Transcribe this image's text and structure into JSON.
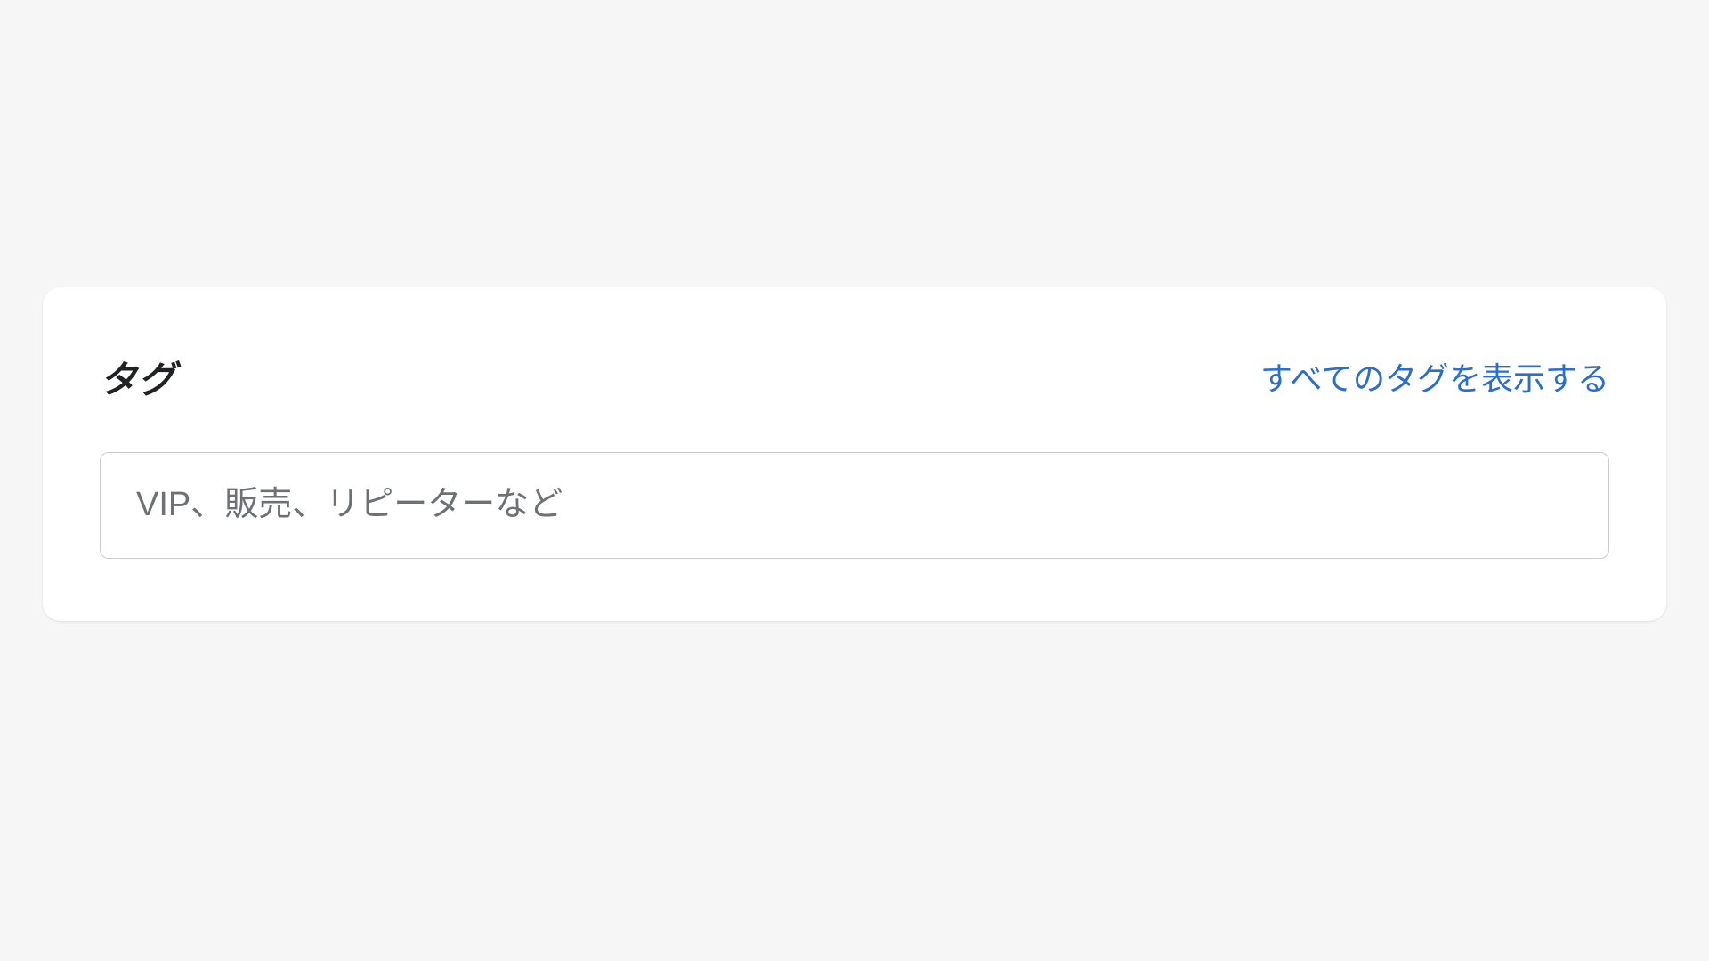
{
  "card": {
    "title": "タグ",
    "show_all_label": "すべてのタグを表示する",
    "input_placeholder": "VIP、販売、リピーターなど",
    "input_value": ""
  }
}
